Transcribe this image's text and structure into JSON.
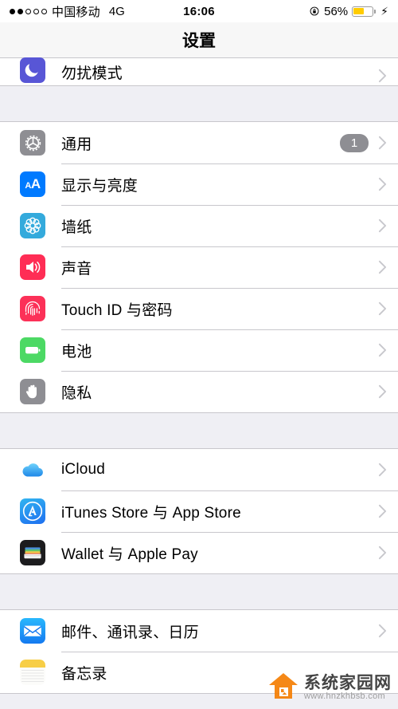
{
  "status_bar": {
    "signal_dots_filled": 2,
    "signal_dots_total": 5,
    "carrier": "中国移动",
    "network_type": "4G",
    "time": "16:06",
    "rotation_lock_icon": "rotation-lock-icon",
    "battery_percent_label": "56%",
    "battery_level": 56,
    "battery_color": "#FFCC00",
    "charging_icon": "⚡"
  },
  "nav": {
    "title": "设置"
  },
  "colors": {
    "page_background": "#EFEFF4",
    "row_background": "#FFFFFF",
    "separator": "#C8C7CC",
    "chevron": "#C7C7CC",
    "badge_background": "#8E8E93",
    "accent_blue": "#007AFF"
  },
  "sections": [
    {
      "id": "section-dnd",
      "partial_top": true,
      "rows": [
        {
          "id": "row-do-not-disturb",
          "label": "勿扰模式",
          "icon": "moon-icon",
          "icon_class": "ic-dnd",
          "badge": null,
          "chevron": true
        }
      ]
    },
    {
      "id": "section-system",
      "partial_top": false,
      "rows": [
        {
          "id": "row-general",
          "label": "通用",
          "icon": "gear-icon",
          "icon_class": "ic-gear",
          "badge": "1",
          "chevron": true
        },
        {
          "id": "row-display-brightness",
          "label": "显示与亮度",
          "icon": "text-size-icon",
          "icon_class": "ic-display",
          "badge": null,
          "chevron": true
        },
        {
          "id": "row-wallpaper",
          "label": "墙纸",
          "icon": "flower-icon",
          "icon_class": "ic-wall",
          "badge": null,
          "chevron": true
        },
        {
          "id": "row-sounds",
          "label": "声音",
          "icon": "speaker-icon",
          "icon_class": "ic-sound",
          "badge": null,
          "chevron": true
        },
        {
          "id": "row-touch-id",
          "label": "Touch ID 与密码",
          "icon": "fingerprint-icon",
          "icon_class": "ic-touch",
          "badge": null,
          "chevron": true
        },
        {
          "id": "row-battery",
          "label": "电池",
          "icon": "battery-icon",
          "icon_class": "ic-batt",
          "badge": null,
          "chevron": true
        },
        {
          "id": "row-privacy",
          "label": "隐私",
          "icon": "hand-icon",
          "icon_class": "ic-priv",
          "badge": null,
          "chevron": true
        }
      ]
    },
    {
      "id": "section-accounts",
      "partial_top": false,
      "rows": [
        {
          "id": "row-icloud",
          "label": "iCloud",
          "icon": "cloud-icon",
          "icon_class": "ic-icloud",
          "badge": null,
          "chevron": true
        },
        {
          "id": "row-itunes-app-store",
          "label": "iTunes Store 与 App Store",
          "icon": "app-store-icon",
          "icon_class": "ic-itunes",
          "badge": null,
          "chevron": true
        },
        {
          "id": "row-wallet-apple-pay",
          "label": "Wallet 与 Apple Pay",
          "icon": "wallet-icon",
          "icon_class": "ic-wallet",
          "badge": null,
          "chevron": true
        }
      ]
    },
    {
      "id": "section-apps",
      "partial_top": false,
      "rows": [
        {
          "id": "row-mail-contacts-calendars",
          "label": "邮件、通讯录、日历",
          "icon": "mail-icon",
          "icon_class": "ic-mail",
          "badge": null,
          "chevron": true
        },
        {
          "id": "row-notes",
          "label": "备忘录",
          "icon": "notes-icon",
          "icon_class": "ic-notes",
          "badge": null,
          "chevron": false
        }
      ]
    }
  ],
  "watermark": {
    "logo_icon": "house-logo-icon",
    "name": "系统家园网",
    "url": "www.hnzkhbsb.com",
    "logo_color": "#F5820B"
  }
}
